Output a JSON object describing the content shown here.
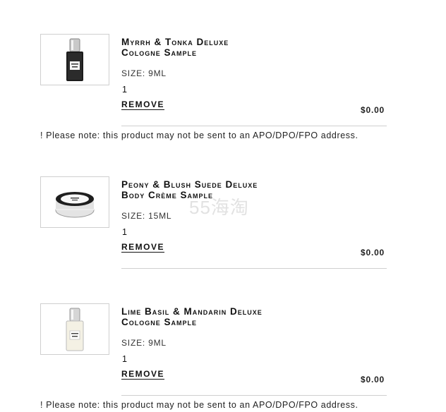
{
  "items": [
    {
      "title_line1": "Myrrh & Tonka Deluxe",
      "title_line2": "Cologne Sample",
      "size": "SIZE: 9ML",
      "quantity": "1",
      "remove_label": "REMOVE",
      "price": "$0.00",
      "image_icon": "cologne-bottle-dark-icon"
    },
    {
      "title_line1": "Peony & Blush Suede Deluxe",
      "title_line2": "Body Crème Sample",
      "size": "SIZE: 15ML",
      "quantity": "1",
      "remove_label": "REMOVE",
      "price": "$0.00",
      "image_icon": "creme-jar-icon"
    },
    {
      "title_line1": "Lime Basil & Mandarin Deluxe",
      "title_line2": "Cologne Sample",
      "size": "SIZE: 9ML",
      "quantity": "1",
      "remove_label": "REMOVE",
      "price": "$0.00",
      "image_icon": "cologne-bottle-light-icon"
    }
  ],
  "notes": [
    "! Please note: this product may not be sent to an APO/DPO/FPO address.",
    "! Please note: this product may not be sent to an APO/DPO/FPO address."
  ],
  "watermark": "55海淘"
}
